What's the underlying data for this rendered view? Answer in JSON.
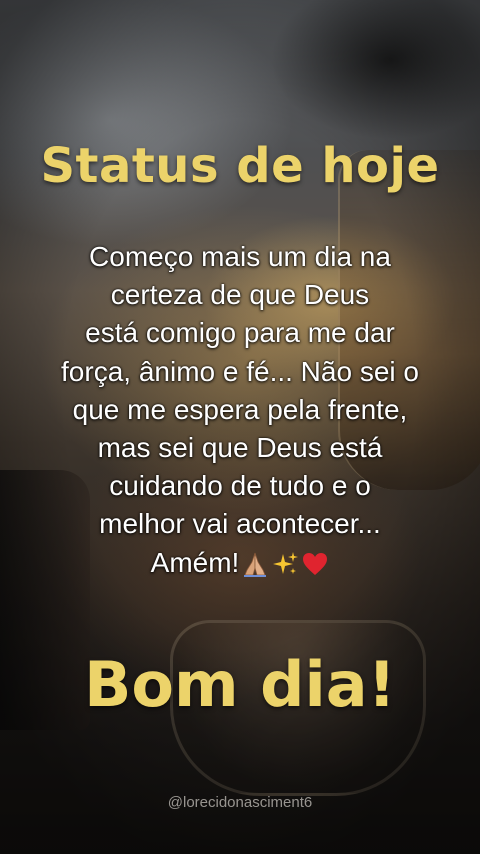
{
  "post": {
    "title": "Status de hoje",
    "message_lines": [
      "Começo mais um dia na",
      "certeza de que Deus",
      "está comigo para me dar",
      "força, ânimo e fé... Não sei o",
      "que me espera pela frente,",
      "mas sei que Deus está",
      "cuidando de tudo e o",
      "melhor vai acontecer...",
      "Amém!"
    ],
    "emojis": [
      "praying-hands-icon",
      "sparkles-icon",
      "red-heart-icon"
    ],
    "greeting": "Bom dia!",
    "watermark": "@lorecidonasciment6"
  },
  "colors": {
    "title": "#ecd36a",
    "message": "#ffffff",
    "heart": "#e0242f",
    "sparkle": "#f7c531"
  }
}
